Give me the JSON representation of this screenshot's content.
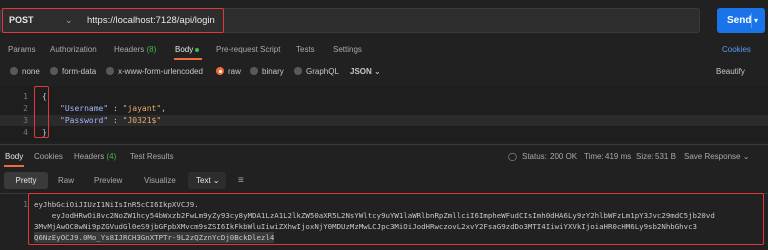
{
  "request": {
    "method": "POST",
    "url": "https://localhost:7128/api/login",
    "send_label": "Send"
  },
  "request_tabs": {
    "params": "Params",
    "authorization": "Authorization",
    "headers": "Headers",
    "headers_count": "(8)",
    "body": "Body",
    "pre_request": "Pre-request Script",
    "tests": "Tests",
    "settings": "Settings",
    "cookies": "Cookies"
  },
  "body_modes": {
    "none": "none",
    "form_data": "form-data",
    "urlencoded": "x-www-form-urlencoded",
    "raw": "raw",
    "binary": "binary",
    "graphql": "GraphQL",
    "format": "JSON",
    "beautify": "Beautify"
  },
  "editor": {
    "line_numbers": [
      "1",
      "2",
      "3",
      "4"
    ],
    "line1": "{",
    "line2_key": "\"Username\"",
    "line2_colon": " : ",
    "line2_val": "\"jayant\"",
    "line2_comma": ",",
    "line3_key": "\"Password\"",
    "line3_colon": " : ",
    "line3_val": "\"J0321$\"",
    "line4": "}"
  },
  "response_tabs": {
    "body": "Body",
    "cookies": "Cookies",
    "headers": "Headers",
    "headers_count": "(4)",
    "test_results": "Test Results"
  },
  "response_meta": {
    "status_label": "Status:",
    "status_value": "200 OK",
    "time_label": "Time:",
    "time_value": "419 ms",
    "size_label": "Size:",
    "size_value": "531 B",
    "save_response": "Save Response"
  },
  "view_modes": {
    "pretty": "Pretty",
    "raw": "Raw",
    "preview": "Preview",
    "visualize": "Visualize",
    "format": "Text"
  },
  "response_body": {
    "line_number": "1",
    "lines": [
      "eyJhbGciOiJIUzI1NiIsInR5cCI6IkpXVCJ9.",
      "    eyJodHRwOi8vc2NoZW1hcy54bWxzb2FwLm9yZy93cy8yMDA1LzA1L2lkZW50aXR5L2NsYWltcy9uYW1laWRlbnRpZmllciI6ImpheWFudCIsImh0dHA6Ly9zY2hlbWFzLm1pY3Jvc29mdC5jb20vd",
      "3MvMjAwOC8wNi9pZGVudGl0eS9jbGFpbXMvcm9sZSI6IkFkbWluIiwiZXhwIjoxNjY0MDUzMzMwLCJpc3MiOiJodHRwczovL2xvY2FsaG9zdDo3MTI4IiwiYXVkIjoiaHR0cHM6Ly9sb2NhbGhvc3",
      "Q6NzEyOCJ9.0Mo_Ys8IJRCH3GnXTPTr-9L2zQZznYcDj0BckDlezl4"
    ]
  },
  "colors": {
    "accent": "#f26b3a",
    "send": "#1a73e8",
    "link": "#5b9bf0",
    "status_ok": "#3fb950",
    "highlight_box": "#e0383b"
  }
}
